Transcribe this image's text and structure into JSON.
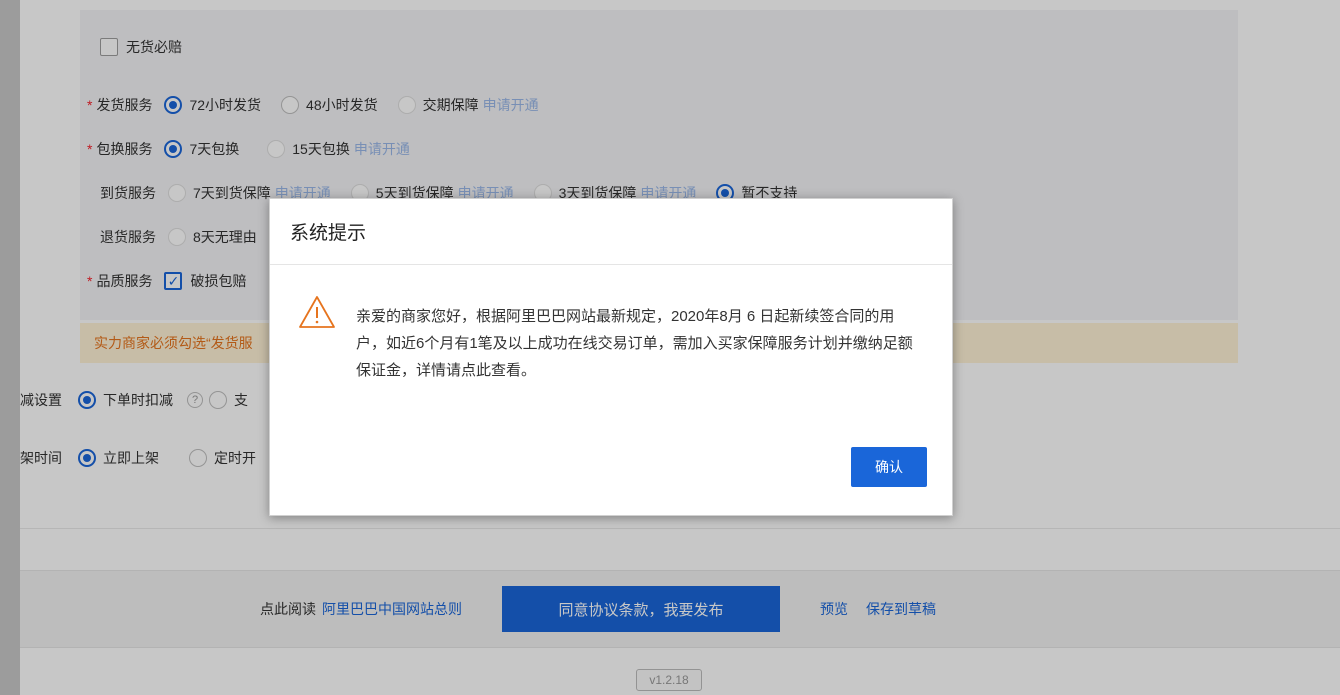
{
  "form": {
    "no_stock_compensation": "无货必赔",
    "shipping_service": {
      "label": "发货服务",
      "options": [
        "72小时发货",
        "48小时发货",
        "交期保障"
      ],
      "apply": "申请开通"
    },
    "exchange_service": {
      "label": "包换服务",
      "options": [
        "7天包换",
        "15天包换"
      ],
      "apply": "申请开通"
    },
    "arrival_service": {
      "label": "到货服务",
      "options": [
        "7天到货保障",
        "5天到货保障",
        "3天到货保障",
        "暂不支持"
      ],
      "apply": "申请开通"
    },
    "return_service": {
      "label": "退货服务",
      "option_partial": "8天无理由"
    },
    "quality_service": {
      "label": "品质服务",
      "option_partial": "破损包赔"
    },
    "notice_partial": "实力商家必须勾选“发货服",
    "stock_deduct": {
      "label_partial": "减设置",
      "option1": "下单时扣减",
      "help": "?",
      "option2_partial": "支"
    },
    "listing_time": {
      "label_partial": "架时间",
      "option1": "立即上架",
      "option2_partial": "定时开"
    }
  },
  "footer": {
    "read_prefix": "点此阅读",
    "rules_link": "阿里巴巴中国网站总则",
    "publish_button": "同意协议条款，我要发布",
    "preview_link": "预览",
    "save_draft_link": "保存到草稿",
    "version": "v1.2.18"
  },
  "dialog": {
    "title": "系统提示",
    "message": "亲爱的商家您好，根据阿里巴巴网站最新规定，2020年8月 6 日起新续签合同的用户，如近6个月有1笔及以上成功在线交易订单，需加入买家保障服务计划并缴纳足额保证金，详情请点此查看。",
    "confirm_button": "确认",
    "icon": "warning-icon"
  },
  "colors": {
    "accent": "#1a66d9",
    "warning": "#e6741e",
    "required": "#f5222d"
  }
}
